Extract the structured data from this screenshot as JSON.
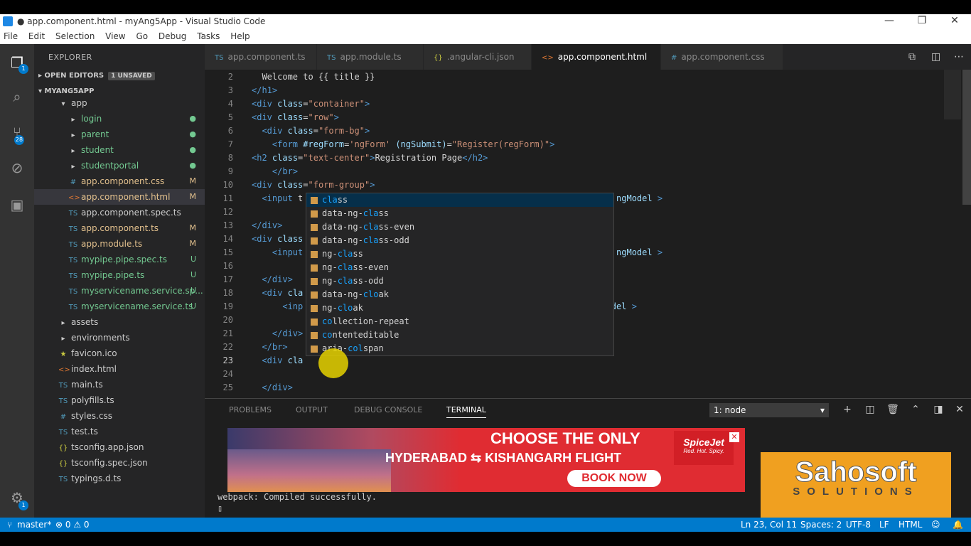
{
  "window": {
    "title": "● app.component.html - myAng5App - Visual Studio Code",
    "controls": [
      "—",
      "❐",
      "✕"
    ]
  },
  "menu": [
    "File",
    "Edit",
    "Selection",
    "View",
    "Go",
    "Debug",
    "Tasks",
    "Help"
  ],
  "activity": {
    "explorer_badge": "1",
    "scm_badge": "28",
    "settings_badge": "1"
  },
  "sidebar": {
    "header": "EXPLORER",
    "open_editors": "OPEN EDITORS",
    "unsaved": "1 UNSAVED",
    "project": "MYANG5APP",
    "items": [
      {
        "label": "app",
        "icon": "folder-open",
        "status": "",
        "color": "#cccccc"
      },
      {
        "label": "login",
        "icon": "folder",
        "status": "●",
        "color": "#73c991"
      },
      {
        "label": "parent",
        "icon": "folder",
        "status": "●",
        "color": "#73c991"
      },
      {
        "label": "student",
        "icon": "folder",
        "status": "●",
        "color": "#73c991"
      },
      {
        "label": "studentportal",
        "icon": "folder",
        "status": "●",
        "color": "#73c991"
      },
      {
        "label": "app.component.css",
        "icon": "#",
        "status": "M",
        "color": "#e2c08d"
      },
      {
        "label": "app.component.html",
        "icon": "<>",
        "status": "M",
        "color": "#e2c08d"
      },
      {
        "label": "app.component.spec.ts",
        "icon": "TS",
        "status": "",
        "color": "#cccccc"
      },
      {
        "label": "app.component.ts",
        "icon": "TS",
        "status": "M",
        "color": "#e2c08d"
      },
      {
        "label": "app.module.ts",
        "icon": "TS",
        "status": "M",
        "color": "#e2c08d"
      },
      {
        "label": "mypipe.pipe.spec.ts",
        "icon": "TS",
        "status": "U",
        "color": "#73c991"
      },
      {
        "label": "mypipe.pipe.ts",
        "icon": "TS",
        "status": "U",
        "color": "#73c991"
      },
      {
        "label": "myservicename.service.sp...",
        "icon": "TS",
        "status": "U",
        "color": "#73c991"
      },
      {
        "label": "myservicename.service.ts",
        "icon": "TS",
        "status": "U",
        "color": "#73c991"
      },
      {
        "label": "assets",
        "icon": "folder",
        "status": "",
        "color": "#cccccc"
      },
      {
        "label": "environments",
        "icon": "folder",
        "status": "",
        "color": "#cccccc"
      },
      {
        "label": "favicon.ico",
        "icon": "★",
        "status": "",
        "color": "#cccccc"
      },
      {
        "label": "index.html",
        "icon": "<>",
        "status": "",
        "color": "#cccccc"
      },
      {
        "label": "main.ts",
        "icon": "TS",
        "status": "",
        "color": "#cccccc"
      },
      {
        "label": "polyfills.ts",
        "icon": "TS",
        "status": "",
        "color": "#cccccc"
      },
      {
        "label": "styles.css",
        "icon": "#",
        "status": "",
        "color": "#cccccc"
      },
      {
        "label": "test.ts",
        "icon": "TS",
        "status": "",
        "color": "#cccccc"
      },
      {
        "label": "tsconfig.app.json",
        "icon": "{}",
        "status": "",
        "color": "#cccccc"
      },
      {
        "label": "tsconfig.spec.json",
        "icon": "{}",
        "status": "",
        "color": "#cccccc"
      },
      {
        "label": "typings.d.ts",
        "icon": "TS",
        "status": "",
        "color": "#cccccc"
      }
    ]
  },
  "tabs": [
    {
      "label": "app.component.ts",
      "icon": "TS"
    },
    {
      "label": "app.module.ts",
      "icon": "TS"
    },
    {
      "label": ".angular-cli.json",
      "icon": "{}"
    },
    {
      "label": "app.component.html",
      "icon": "<>",
      "dirty": "●"
    },
    {
      "label": "app.component.css",
      "icon": "#"
    }
  ],
  "editor": {
    "lines": [
      {
        "n": "2",
        "html": "<span class='tx'>  Welcome to {{ title }}</span>"
      },
      {
        "n": "3",
        "html": "<span class='tg'>&lt;/h1&gt;</span>"
      },
      {
        "n": "4",
        "html": "<span class='tg'>&lt;div</span> <span class='at'>class</span>=<span class='sv'>\"container\"</span><span class='tg'>&gt;</span>"
      },
      {
        "n": "5",
        "html": "<span class='tg'>&lt;div</span> <span class='at'>class</span>=<span class='sv'>\"row\"</span><span class='tg'>&gt;</span>"
      },
      {
        "n": "6",
        "html": "  <span class='tg'>&lt;div</span> <span class='at'>class</span>=<span class='sv'>\"form-bg\"</span><span class='tg'>&gt;</span>"
      },
      {
        "n": "7",
        "html": "    <span class='tg'>&lt;form</span> <span class='at'>#regForm</span>=<span class='sv'>'ngForm'</span> <span class='at'>(ngSubmit)</span>=<span class='sv'>\"Register(regForm)\"</span><span class='tg'>&gt;</span>"
      },
      {
        "n": "8",
        "html": "<span class='tg'>&lt;h2</span> <span class='at'>class</span>=<span class='sv'>\"text-center\"</span><span class='tg'>&gt;</span>Registration Page<span class='tg'>&lt;/h2&gt;</span>"
      },
      {
        "n": "9",
        "html": "    <span class='tg'>&lt;/br&gt;</span>"
      },
      {
        "n": "10",
        "html": "<span class='tg'>&lt;div</span> <span class='at'>class</span>=<span class='sv'>\"form-group\"</span><span class='tg'>&gt;</span>"
      },
      {
        "n": "11",
        "html": "  <span class='tg'>&lt;input</span> t                                            <span class='at'>name</span>=<span class='sv'>\"firstname\"</span> <span class='at'>ngModel</span> <span class='tg'>&gt;</span>"
      },
      {
        "n": "12",
        "html": ""
      },
      {
        "n": "13",
        "html": "<span class='tg'>&lt;/div&gt;</span>"
      },
      {
        "n": "14",
        "html": "<span class='tg'>&lt;div</span> <span class='at'>class</span>"
      },
      {
        "n": "15",
        "html": "    <span class='tg'>&lt;input</span>                                           <span class='sv'>\"</span> <span class='at'>name</span>=<span class='sv'>\"lastname\"</span> <span class='at'>ngModel</span> <span class='tg'>&gt;</span>"
      },
      {
        "n": "16",
        "html": ""
      },
      {
        "n": "17",
        "html": "  <span class='tg'>&lt;/div&gt;</span>"
      },
      {
        "n": "18",
        "html": "  <span class='tg'>&lt;div</span> <span class='at'>cla</span>"
      },
      {
        "n": "19",
        "html": "      <span class='tg'>&lt;inp</span>                                         <span class='sv'>\"</span> <span class='at'>name</span>=<span class='sv'>\"email\"</span> <span class='at'>ngModel</span> <span class='tg'>&gt;</span>"
      },
      {
        "n": "20",
        "html": ""
      },
      {
        "n": "21",
        "html": "    <span class='tg'>&lt;/div&gt;</span>"
      },
      {
        "n": "22",
        "html": "  <span class='tg'>&lt;/br&gt;</span>"
      },
      {
        "n": "23",
        "html": "  <span class='tg'>&lt;div</span> <span class='at'>cla</span>"
      },
      {
        "n": "24",
        "html": ""
      },
      {
        "n": "25",
        "html": "  <span class='tg'>&lt;/div&gt;</span>"
      }
    ],
    "suggestions": [
      {
        "pre": "",
        "match": "cla",
        "post": "ss"
      },
      {
        "pre": "data-ng-",
        "match": "cla",
        "post": "ss"
      },
      {
        "pre": "data-ng-",
        "match": "cla",
        "post": "ss-even"
      },
      {
        "pre": "data-ng-",
        "match": "cla",
        "post": "ss-odd"
      },
      {
        "pre": "ng-",
        "match": "cla",
        "post": "ss"
      },
      {
        "pre": "ng-",
        "match": "cla",
        "post": "ss-even"
      },
      {
        "pre": "ng-",
        "match": "cla",
        "post": "ss-odd"
      },
      {
        "pre": "data-ng-",
        "match": "clo",
        "post": "ak"
      },
      {
        "pre": "ng-",
        "match": "clo",
        "post": "ak"
      },
      {
        "pre": "",
        "match": "co",
        "post": "llection-repeat"
      },
      {
        "pre": "",
        "match": "co",
        "post": "ntenteditable"
      },
      {
        "pre": "aria-",
        "match": "col",
        "post": "span"
      }
    ]
  },
  "panel": {
    "tabs": [
      "PROBLEMS",
      "OUTPUT",
      "DEBUG CONSOLE",
      "TERMINAL"
    ],
    "terminal_select": "1: node",
    "terminal_lines": [
      "webpack: Compiled successfully."
    ]
  },
  "ad": {
    "line1": "CHOOSE THE ONLY",
    "from": "HYDERABAD",
    "to": "KISHANGARH FLIGHT",
    "cta": "BOOK NOW",
    "brand": "SpiceJet",
    "tagline": "Red. Hot. Spicy."
  },
  "watermark": {
    "name": "Sahosoft",
    "sub": "SOLUTIONS"
  },
  "status": {
    "branch": "master*",
    "problems": "⊗ 0  ⚠ 0",
    "position": "Ln 23, Col 11",
    "spaces": "Spaces: 2",
    "encoding": "UTF-8",
    "eol": "LF",
    "language": "HTML"
  }
}
